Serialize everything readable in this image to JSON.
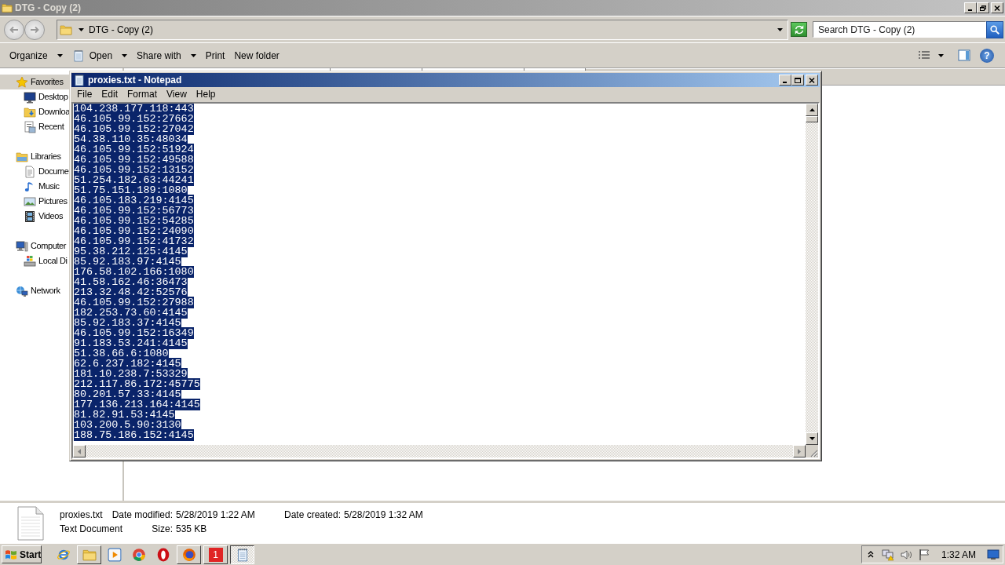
{
  "explorer": {
    "title": "DTG - Copy (2)",
    "address": "DTG - Copy (2)",
    "search": {
      "placeholder": "Search DTG - Copy (2)"
    },
    "toolbar": [
      {
        "label": "Organize",
        "kind": "dropdown"
      },
      {
        "label": "Open",
        "kind": "dropdown-icon"
      },
      {
        "label": "Share with",
        "kind": "dropdown"
      },
      {
        "label": "Print",
        "kind": "plain"
      },
      {
        "label": "New folder",
        "kind": "plain"
      }
    ],
    "help": "?",
    "nav": [
      {
        "label": "Favorites",
        "selected": true,
        "children": [
          {
            "label": "Desktop",
            "selected": false
          },
          {
            "label": "Downloa",
            "selected": false
          },
          {
            "label": "Recent",
            "selected": false
          }
        ]
      },
      {
        "label": "Libraries",
        "selected": false,
        "children": [
          {
            "label": "Docume",
            "selected": false
          },
          {
            "label": "Music",
            "selected": false
          },
          {
            "label": "Pictures",
            "selected": false
          },
          {
            "label": "Videos",
            "selected": false
          }
        ]
      },
      {
        "label": "Computer",
        "selected": false,
        "children": [
          {
            "label": "Local Di",
            "selected": false
          }
        ]
      },
      {
        "label": "Network",
        "selected": false
      }
    ],
    "details": {
      "name": "proxies.txt",
      "type": "Text Document",
      "columns": [
        [
          {
            "label": "Date modified:",
            "value": "5/28/2019 1:22 AM"
          },
          {
            "label": "Size:",
            "value": "535 KB"
          }
        ],
        [
          {
            "label": "Date created:",
            "value": "5/28/2019 1:32 AM"
          }
        ]
      ]
    }
  },
  "notepad": {
    "title": "proxies.txt - Notepad",
    "menu": [
      "File",
      "Edit",
      "Format",
      "View",
      "Help"
    ],
    "selected": true,
    "lines": [
      "104.238.177.118:443",
      "46.105.99.152:27662",
      "46.105.99.152:27042",
      "54.38.110.35:48034",
      "46.105.99.152:51924",
      "46.105.99.152:49588",
      "46.105.99.152:13152",
      "51.254.182.63:44241",
      "51.75.151.189:1080",
      "46.105.183.219:4145",
      "46.105.99.152:56773",
      "46.105.99.152:54285",
      "46.105.99.152:24090",
      "46.105.99.152:41732",
      "95.38.212.125:4145",
      "85.92.183.97:4145",
      "176.58.102.166:1080",
      "41.58.162.46:36473",
      "213.32.48.42:52576",
      "46.105.99.152:27988",
      "182.253.73.60:4145",
      "85.92.183.37:4145",
      "46.105.99.152:16349",
      "91.183.53.241:4145",
      "51.38.66.6:1080",
      "62.6.237.182:4145",
      "181.10.238.7:53329",
      "212.117.86.172:45775",
      "80.201.57.33:4145",
      "177.136.213.164:4145",
      "81.82.91.53:4145",
      "103.200.5.90:3130",
      "188.75.186.152:4145"
    ]
  },
  "taskbar": {
    "start": "Start",
    "items": [
      {
        "kind": "launcher"
      },
      {
        "kind": "window",
        "selected": false
      },
      {
        "kind": "launcher"
      },
      {
        "kind": "launcher"
      },
      {
        "kind": "launcher"
      },
      {
        "kind": "window",
        "selected": false
      },
      {
        "kind": "window",
        "selected": false,
        "text": "1"
      },
      {
        "kind": "window",
        "selected": true
      }
    ],
    "clock": "1:32 AM"
  }
}
